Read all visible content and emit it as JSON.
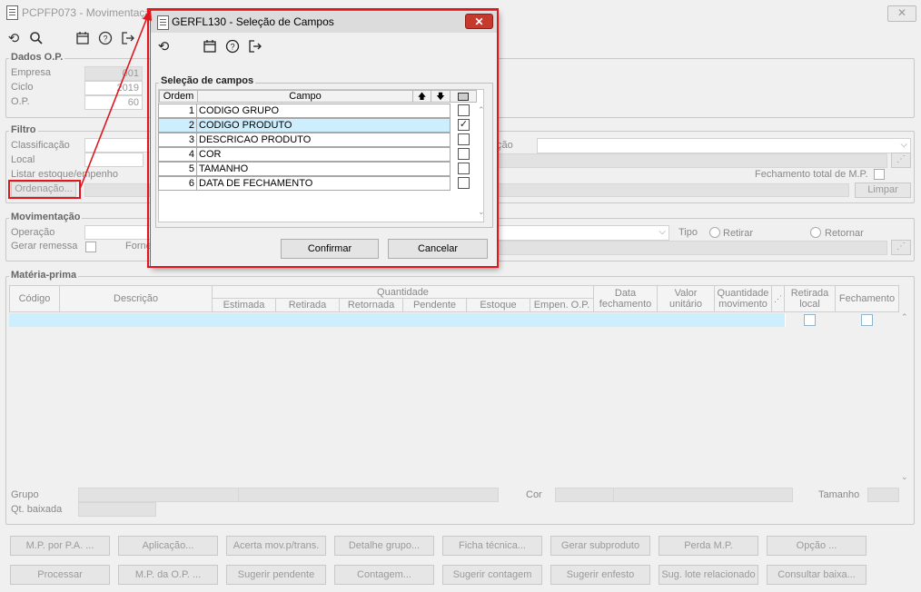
{
  "main_window": {
    "title": "PCPFP073 - Movimentaçã"
  },
  "dados_op": {
    "label": "Dados O.P.",
    "empresa_label": "Empresa",
    "empresa_value": "001",
    "ciclo_label": "Ciclo",
    "ciclo_value": "2019",
    "op_label": "O.P.",
    "op_value": "60"
  },
  "filtro": {
    "label": "Filtro",
    "classificacao_label": "Classificação",
    "local_label": "Local",
    "listar_label": "Listar estoque/empenho",
    "ordenacao_button": "Ordenação...",
    "cao_label": "ção",
    "fechamento_total_label": "Fechamento total de M.P.",
    "limpar_button": "Limpar"
  },
  "movimentacao": {
    "label": "Movimentação",
    "operacao_label": "Operação",
    "gerar_remessa_label": "Gerar remessa",
    "forne_label": "Forne",
    "tipo_label": "Tipo",
    "retirar_label": "Retirar",
    "retornar_label": "Retornar"
  },
  "materia_prima": {
    "label": "Matéria-prima",
    "headers": {
      "codigo": "Código",
      "descricao": "Descrição",
      "quantidade": "Quantidade",
      "estimada": "Estimada",
      "retirada": "Retirada",
      "retornada": "Retornada",
      "pendente": "Pendente",
      "estoque": "Estoque",
      "empen_op": "Empen. O.P.",
      "data_fechamento": "Data fechamento",
      "valor_unitario": "Valor unitário",
      "quantidade_movimento": "Quantidade movimento",
      "retirada_local": "Retirada local",
      "fechamento": "Fechamento"
    },
    "grupo_label": "Grupo",
    "cor_label": "Cor",
    "tamanho_label": "Tamanho",
    "qt_baixada_label": "Qt. baixada"
  },
  "bottom_buttons_row1": [
    "M.P. por P.A. ...",
    "Aplicação...",
    "Acerta mov.p/trans.",
    "Detalhe grupo...",
    "Ficha técnica...",
    "Gerar subproduto",
    "Perda M.P.",
    "Opção ..."
  ],
  "bottom_buttons_row2": [
    "Processar",
    "M.P. da O.P. ...",
    "Sugerir pendente",
    "Contagem...",
    "Sugerir contagem",
    "Sugerir enfesto",
    "Sug. lote relacionado",
    "Consultar baixa..."
  ],
  "dialog": {
    "title": "GERFL130 - Seleção de Campos",
    "group_label": "Seleção de campos",
    "col_ordem": "Ordem",
    "col_campo": "Campo",
    "rows": [
      {
        "ordem": "1",
        "campo": "CODIGO GRUPO",
        "checked": false
      },
      {
        "ordem": "2",
        "campo": "CODIGO PRODUTO",
        "checked": true
      },
      {
        "ordem": "3",
        "campo": "DESCRICAO PRODUTO",
        "checked": false
      },
      {
        "ordem": "4",
        "campo": "COR",
        "checked": false
      },
      {
        "ordem": "5",
        "campo": "TAMANHO",
        "checked": false
      },
      {
        "ordem": "6",
        "campo": "DATA DE FECHAMENTO",
        "checked": false
      }
    ],
    "confirmar_button": "Confirmar",
    "cancelar_button": "Cancelar"
  },
  "colors": {
    "highlight": "#e0161d",
    "selection": "#cdeefc",
    "close_button": "#c7392c"
  }
}
